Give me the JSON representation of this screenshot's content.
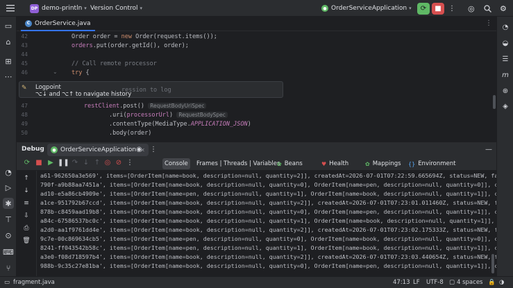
{
  "titlebar": {
    "project_badge": "DP",
    "project_name": "demo-println",
    "vcs_label": "Version Control",
    "run_config": "OrderServiceApplication",
    "menu_icon": "hamburger-icon",
    "run_icons": [
      "restart-icon",
      "stop-icon"
    ],
    "right_icons": [
      "ai-assistant-icon",
      "search-icon",
      "settings-icon"
    ]
  },
  "editor": {
    "tab_label": "OrderService.java",
    "lines": [
      {
        "num": "42",
        "text": "Order order = new Order(request.items());"
      },
      {
        "num": "43",
        "text": "orders.put(order.getId(), order);"
      },
      {
        "num": "44",
        "text": ""
      },
      {
        "num": "45",
        "text": "// Call remote processor"
      },
      {
        "num": "46",
        "text": "try {"
      },
      {
        "num": "47",
        "text": "restClient.post()"
      },
      {
        "num": "48",
        "text": ".uri(processorUrl)"
      },
      {
        "num": "49",
        "text": ".contentType(MediaType.APPLICATION_JSON)"
      },
      {
        "num": "50",
        "text": ".body(order)"
      }
    ],
    "hint_body_uri": "RequestBodyUriSpec",
    "hint_body_spec": "RequestBodySpec",
    "const_json": "APPLICATION_JSON"
  },
  "tooltip": {
    "title": "Logpoint",
    "description": "⌥↓ and ⌥↑ to navigate history",
    "placeholder": "ression to log"
  },
  "debug": {
    "title": "Debug",
    "session": "OrderServiceApplication",
    "tabs": [
      {
        "label": "Console",
        "icon": "console-icon"
      },
      {
        "label": "Frames | Threads | Variables",
        "icon": "frames-icon"
      },
      {
        "label": "Beans",
        "icon": "beans-icon"
      },
      {
        "label": "Health",
        "icon": "health-icon"
      },
      {
        "label": "Mappings",
        "icon": "mappings-icon"
      },
      {
        "label": "Environment",
        "icon": "environment-icon"
      }
    ],
    "log_lines": [
      "a61-962650a3e569', items=[OrderItem[name=book, description=null, quantity=2]], createdAt=2026-07-01T07:22:59.665694Z, status=NEW, failureReaso",
      "790f-a9b88aa7451a', items=[OrderItem[name=book, description=null, quantity=0], OrderItem[name=pen, description=null, quantity=0]], createdAt=20",
      "ad10-e5a86cb4909e', items=[OrderItem[name=pen, description=null, quantity=1], OrderItem[name=book, description=null, quantity=1]], createdAt=20",
      "a1ce-951792b67ccd', items=[OrderItem[name=book, description=null, quantity=2]], createdAt=2026-07-01T07:23:01.011460Z, status=NEW, failureReaso",
      "878b-c8459aad19b8', items=[OrderItem[name=book, description=null, quantity=0], OrderItem[name=pen, description=null, quantity=1]], createdAt=20",
      "a84c-67586537bc0c', items=[OrderItem[name=book, description=null, quantity=1], OrderItem[name=book, description=null, quantity=1]], createdAt=20",
      "a2d0-aa1f9761dd4e', items=[OrderItem[name=book, description=null, quantity=2]], createdAt=2026-07-01T07:23:02.175333Z, status=NEW, failureReaso",
      "9c7e-00c869634cb5', items=[OrderItem[name=pen, description=null, quantity=0], OrderItem[name=book, description=null, quantity=0]], createdAt=20",
      "8241-ff043542b58c', items=[OrderItem[name=pen, description=null, quantity=1], OrderItem[name=book, description=null, quantity=1]], createdAt=20",
      "a3e0-f08d718597b4', items=[OrderItem[name=book, description=null, quantity=2]], createdAt=2026-07-01T07:23:03.440654Z, status=NEW, failureReaso",
      "988b-9c35c27e81ba', items=[OrderItem[name=book, description=null, quantity=0], OrderItem[name=pen, description=null, quantity=1]], createdAt=20"
    ]
  },
  "statusbar": {
    "file": "fragment.java",
    "position": "47:13",
    "line_sep": "LF",
    "encoding": "UTF-8",
    "indent": "4 spaces"
  },
  "colors": {
    "accent": "#3574f0",
    "stop_red": "#d64f4f",
    "restart_green": "#5fb865",
    "project_badge": "#8f5fd6"
  }
}
